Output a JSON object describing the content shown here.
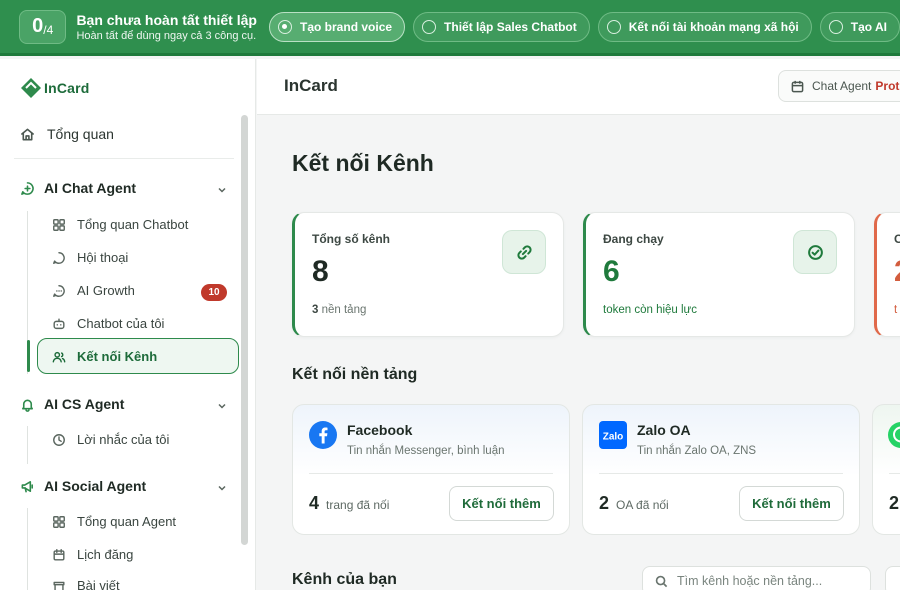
{
  "banner": {
    "progress_done": "0",
    "progress_total": "/4",
    "title": "Bạn chưa hoàn tất thiết lập",
    "subtitle": "Hoàn tất để dùng ngay cả 3 công cụ.",
    "steps": [
      {
        "label": "Tạo brand voice",
        "active": true
      },
      {
        "label": "Thiết lập Sales Chatbot",
        "active": false
      },
      {
        "label": "Kết nối tài khoản mạng xã hội",
        "active": false
      },
      {
        "label": "Tạo AI",
        "active": false
      }
    ]
  },
  "sidebar": {
    "logo_text": "InCard",
    "overview": "Tổng quan",
    "sections": [
      {
        "label": "AI Chat Agent",
        "icon": "chat-plus-icon",
        "items": [
          {
            "label": "Tổng quan Chatbot",
            "icon": "grid-icon"
          },
          {
            "label": "Hội thoại",
            "icon": "message-icon"
          },
          {
            "label": "AI Growth",
            "icon": "message-dots-icon",
            "badge": "10"
          },
          {
            "label": "Chatbot của tôi",
            "icon": "robot-icon"
          },
          {
            "label": "Kết nối Kênh",
            "icon": "users-icon",
            "active": true
          }
        ]
      },
      {
        "label": "AI CS Agent",
        "icon": "bell-icon",
        "items": [
          {
            "label": "Lời nhắc của tôi",
            "icon": "clock-icon"
          }
        ]
      },
      {
        "label": "AI Social Agent",
        "icon": "megaphone-icon",
        "items": [
          {
            "label": "Tổng quan Agent",
            "icon": "grid-icon"
          },
          {
            "label": "Lịch đăng",
            "icon": "calendar-icon"
          },
          {
            "label": "Bài viết",
            "icon": "document-icon"
          }
        ]
      }
    ]
  },
  "header": {
    "title": "InCard",
    "agent_label": "Chat Agent",
    "agent_value": "Prot"
  },
  "main": {
    "page_title": "Kết nối Kênh",
    "stats": [
      {
        "label": "Tổng số kênh",
        "value": "8",
        "sub_num": "3",
        "sub_text": "nền tảng",
        "icon": "link-icon"
      },
      {
        "label": "Đang chạy",
        "value": "6",
        "sub_text": "token còn hiệu lực",
        "icon": "check-circle-icon"
      },
      {
        "label": "C",
        "value": "2",
        "sub_text": "t"
      }
    ],
    "platforms_title": "Kết nối nền tảng",
    "platforms": [
      {
        "name": "Facebook",
        "desc": "Tin nhắn Messenger, bình luận",
        "count": "4",
        "unit": "trang đã nối",
        "button": "Kết nối thêm",
        "color": "#1877f2"
      },
      {
        "name": "Zalo OA",
        "desc": "Tin nhắn Zalo OA, ZNS",
        "count": "2",
        "unit": "OA đã nối",
        "button": "Kết nối thêm",
        "color": "#0068ff",
        "logo_text": "Zalo"
      },
      {
        "name": "",
        "desc": "",
        "count": "2",
        "unit": "",
        "button": "",
        "color": "#25d366"
      }
    ],
    "channels_title": "Kênh của bạn",
    "search_placeholder": "Tìm kênh hoặc nền tảng..."
  }
}
